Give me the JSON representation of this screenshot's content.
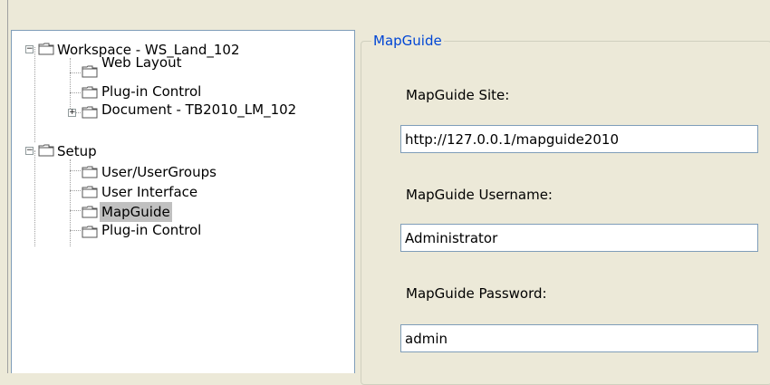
{
  "tree": {
    "nodes": [
      {
        "label": "Workspace - WS_Land_102",
        "icon": "folder-icon",
        "expander": "minus"
      },
      {
        "label": "Web Layout",
        "icon": "folder-icon"
      },
      {
        "label": "Plug-in Control",
        "icon": "folder-icon"
      },
      {
        "label": "Document - TB2010_LM_102",
        "icon": "folder-icon",
        "expander": "plus"
      },
      {
        "label": "Setup",
        "icon": "folder-icon",
        "expander": "minus"
      },
      {
        "label": "User/UserGroups",
        "icon": "folder-icon"
      },
      {
        "label": "User Interface",
        "icon": "folder-icon"
      },
      {
        "label": "MapGuide",
        "icon": "folder-icon",
        "selected": true
      },
      {
        "label": "Plug-in Control",
        "icon": "folder-icon"
      }
    ],
    "expander_symbols": {
      "minus": "−",
      "plus": "+"
    }
  },
  "mapguide": {
    "group_title": "MapGuide",
    "site_label": "MapGuide Site:",
    "site_value": "http://127.0.0.1/mapguide2010",
    "username_label": "MapGuide Username:",
    "username_value": "Administrator",
    "password_label": "MapGuide Password:",
    "password_value": "admin"
  },
  "colors": {
    "window_bg": "#ece9d8",
    "group_title": "#0046d5",
    "selection_bg": "#c0c0c0",
    "input_border": "#7f9db9"
  }
}
